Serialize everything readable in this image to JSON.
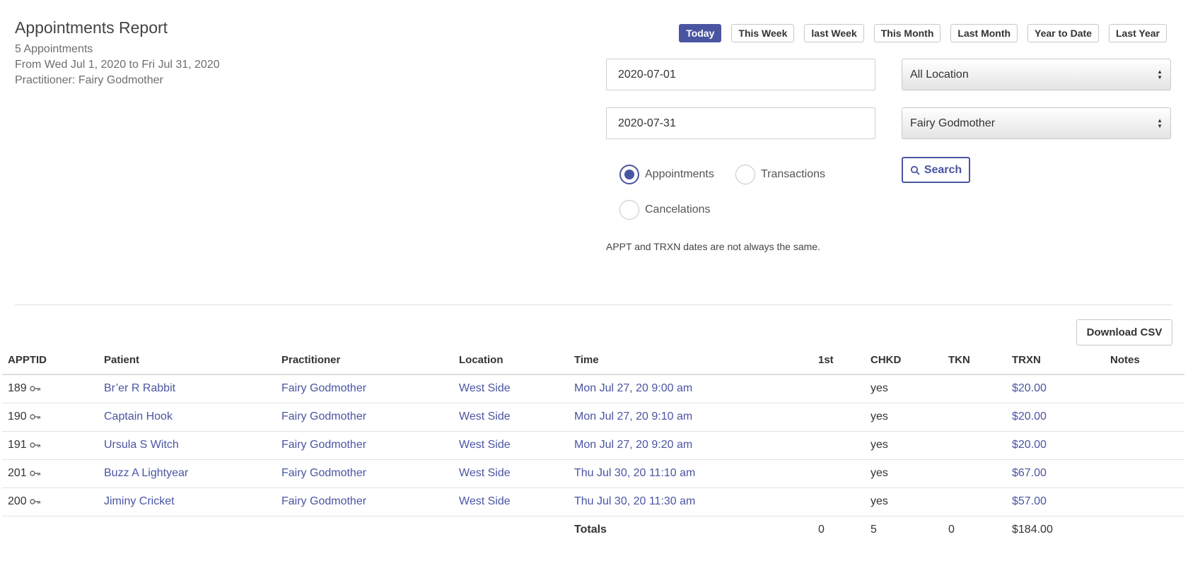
{
  "report": {
    "title": "Appointments Report",
    "count_text": "5 Appointments",
    "range_text": "From Wed Jul 1, 2020 to Fri Jul 31, 2020",
    "practitioner_text": "Practitioner: Fairy Godmother"
  },
  "range_buttons": [
    "Today",
    "This Week",
    "last Week",
    "This Month",
    "Last Month",
    "Year to Date",
    "Last Year"
  ],
  "filters": {
    "start_date": "2020-07-01",
    "end_date": "2020-07-31",
    "location": "All Location",
    "practitioner": "Fairy Godmother",
    "radios": {
      "appointments": "Appointments",
      "transactions": "Transactions",
      "cancelations": "Cancelations"
    },
    "search_label": "Search",
    "note": "APPT and TRXN dates are not always the same."
  },
  "download_csv": "Download CSV",
  "table": {
    "headers": [
      "APPTID",
      "Patient",
      "Practitioner",
      "Location",
      "Time",
      "1st",
      "CHKD",
      "TKN",
      "TRXN",
      "Notes"
    ],
    "rows": [
      {
        "id": "189",
        "patient": "Br’er R Rabbit",
        "practitioner": "Fairy Godmother",
        "location": "West Side",
        "time": "Mon Jul 27, 20 9:00 am",
        "first": "",
        "chkd": "yes",
        "tkn": "",
        "trxn": "$20.00",
        "notes": ""
      },
      {
        "id": "190",
        "patient": "Captain Hook",
        "practitioner": "Fairy Godmother",
        "location": "West Side",
        "time": "Mon Jul 27, 20 9:10 am",
        "first": "",
        "chkd": "yes",
        "tkn": "",
        "trxn": "$20.00",
        "notes": ""
      },
      {
        "id": "191",
        "patient": "Ursula S Witch",
        "practitioner": "Fairy Godmother",
        "location": "West Side",
        "time": "Mon Jul 27, 20 9:20 am",
        "first": "",
        "chkd": "yes",
        "tkn": "",
        "trxn": "$20.00",
        "notes": ""
      },
      {
        "id": "201",
        "patient": "Buzz A Lightyear",
        "practitioner": "Fairy Godmother",
        "location": "West Side",
        "time": "Thu Jul 30, 20 11:10 am",
        "first": "",
        "chkd": "yes",
        "tkn": "",
        "trxn": "$67.00",
        "notes": ""
      },
      {
        "id": "200",
        "patient": "Jiminy Cricket",
        "practitioner": "Fairy Godmother",
        "location": "West Side",
        "time": "Thu Jul 30, 20 11:30 am",
        "first": "",
        "chkd": "yes",
        "tkn": "",
        "trxn": "$57.00",
        "notes": ""
      }
    ],
    "totals": {
      "label": "Totals",
      "first": "0",
      "chkd": "5",
      "tkn": "0",
      "trxn": "$184.00"
    }
  },
  "colors": {
    "accent": "#4a55a2"
  },
  "icons": {
    "row_key": "key-icon",
    "search": "search-icon"
  }
}
